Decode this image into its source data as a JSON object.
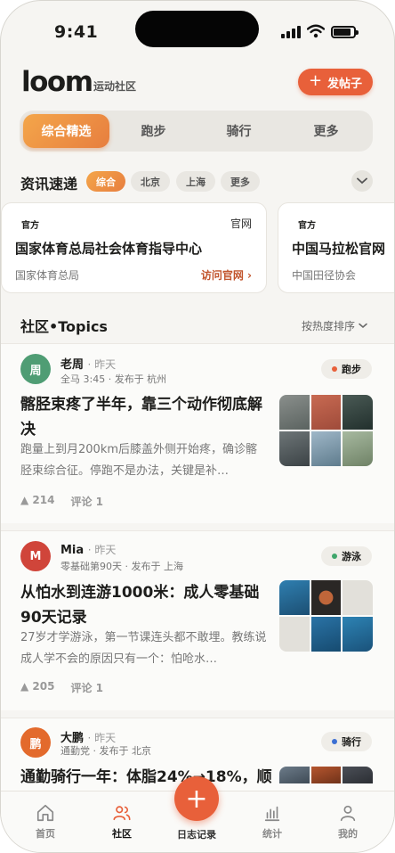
{
  "status_bar": {
    "time": "9:41"
  },
  "header": {
    "logo": "loom",
    "subtitle": "运动社区",
    "post_button": "发帖子"
  },
  "tabs": [
    {
      "label": "综合精选",
      "active": true
    },
    {
      "label": "跑步",
      "active": false
    },
    {
      "label": "骑行",
      "active": false
    },
    {
      "label": "更多",
      "active": false
    }
  ],
  "news": {
    "title": "资讯速递",
    "filters": [
      "综合",
      "北京",
      "上海",
      "更多"
    ],
    "cards": [
      {
        "tag": "官方",
        "tag_right": "官网",
        "title": "国家体育总局社会体育指导中心",
        "source": "国家体育总局",
        "link": "访问官网 ›"
      },
      {
        "tag": "官方",
        "tag_right": "",
        "title": "中国马拉松官网",
        "source": "中国田径协会",
        "link": ""
      }
    ]
  },
  "topics": {
    "title": "社区•Topics",
    "sort": "按热度排序"
  },
  "posts": [
    {
      "avatar": "周",
      "avatar_color": "#4f9d74",
      "name": "老周",
      "ago": "· 昨天",
      "meta": "全马 3:45 · 发布于 杭州",
      "tag": "跑步",
      "tag_color": "#e8603a",
      "title": "髂胫束疼了半年，靠三个动作彻底解决",
      "excerpt": "跑量上到月200km后膝盖外侧开始疼，确诊髂胫束综合征。停跑不是办法，关键是补…",
      "likes": "▲ 214",
      "comments": "评论 1"
    },
    {
      "avatar": "M",
      "avatar_color": "#d0453a",
      "name": "Mia",
      "ago": "· 昨天",
      "meta": "零基础第90天 · 发布于 上海",
      "tag": "游泳",
      "tag_color": "#3fa66b",
      "title": "从怕水到连游1000米：成人零基础90天记录",
      "excerpt": "27岁才学游泳，第一节课连头都不敢埋。教练说成人学不会的原因只有一个：怕呛水…",
      "likes": "▲ 205",
      "comments": "评论 1"
    },
    {
      "avatar": "鹏",
      "avatar_color": "#e36a2c",
      "name": "大鹏",
      "ago": "· 昨天",
      "meta": "通勤党 · 发布于 北京",
      "tag": "骑行",
      "tag_color": "#3b6fd3",
      "title": "通勤骑行一年：体脂24%→18%，顺",
      "excerpt": "",
      "likes": "",
      "comments": ""
    }
  ],
  "bottom_nav": [
    {
      "label": "首页",
      "icon": "home-icon",
      "active": false
    },
    {
      "label": "社区",
      "icon": "community-icon",
      "active": true
    },
    {
      "label": "日志记录",
      "icon": "plus-icon",
      "active": false
    },
    {
      "label": "统计",
      "icon": "stats-icon",
      "active": false
    },
    {
      "label": "我的",
      "icon": "profile-icon",
      "active": false
    }
  ],
  "colors": {
    "accent": "#e8603a",
    "gold": "#f0a044"
  }
}
